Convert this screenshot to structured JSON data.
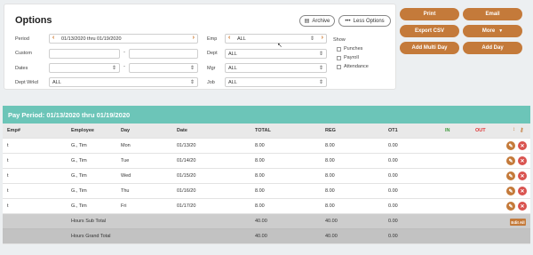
{
  "options": {
    "title": "Options",
    "archive_label": "Archive",
    "less_options_label": "Less Options",
    "period_label": "Period",
    "period_value": "01/13/2020 thru 01/19/2020",
    "custom_label": "Custom",
    "dates_label": "Dates",
    "dept_wrkd_label": "Dept Wrkd",
    "dept_wrkd_value": "ALL",
    "emp_label": "Emp",
    "emp_value": "ALL",
    "dept_label": "Dept",
    "dept_value": "ALL",
    "mgr_label": "Mgr",
    "mgr_value": "ALL",
    "job_label": "Job",
    "job_value": "ALL",
    "show_label": "Show",
    "show_options": [
      "Punches",
      "Payroll",
      "Attendance"
    ]
  },
  "actions": {
    "print": "Print",
    "email": "Email",
    "export_csv": "Export CSV",
    "more": "More",
    "add_multi_day": "Add Multi Day",
    "add_day": "Add Day"
  },
  "pay_period": "Pay Period: 01/13/2020 thru 01/19/2020",
  "table": {
    "headers": {
      "emp": "Emp#",
      "employee": "Employee",
      "day": "Day",
      "date": "Date",
      "total": "TOTAL",
      "reg": "REG",
      "ot1": "OT1",
      "in": "IN",
      "out": "OUT"
    },
    "rows": [
      {
        "emp": "t",
        "employee": "G., Tim",
        "day": "Mon",
        "date": "01/13/20",
        "total": "8.00",
        "reg": "8.00",
        "ot1": "0.00"
      },
      {
        "emp": "t",
        "employee": "G., Tim",
        "day": "Tue",
        "date": "01/14/20",
        "total": "8.00",
        "reg": "8.00",
        "ot1": "0.00"
      },
      {
        "emp": "t",
        "employee": "G., Tim",
        "day": "Wed",
        "date": "01/15/20",
        "total": "8.00",
        "reg": "8.00",
        "ot1": "0.00"
      },
      {
        "emp": "t",
        "employee": "G., Tim",
        "day": "Thu",
        "date": "01/16/20",
        "total": "8.00",
        "reg": "8.00",
        "ot1": "0.00"
      },
      {
        "emp": "t",
        "employee": "G., Tim",
        "day": "Fri",
        "date": "01/17/20",
        "total": "8.00",
        "reg": "8.00",
        "ot1": "0.00"
      }
    ],
    "subtotal": {
      "label": "Hours Sub Total",
      "total": "40.00",
      "reg": "40.00",
      "ot1": "0.00",
      "edit_all": "Edit All"
    },
    "grand_total": {
      "label": "Hours Grand Total",
      "total": "40.00",
      "reg": "40.00",
      "ot1": "0.00"
    }
  },
  "colors": {
    "accent": "#c47a3a",
    "teal_header": "#6cc5b8",
    "delete": "#d9534f",
    "in_color": "#3c9a3c",
    "out_color": "#dd3333"
  }
}
